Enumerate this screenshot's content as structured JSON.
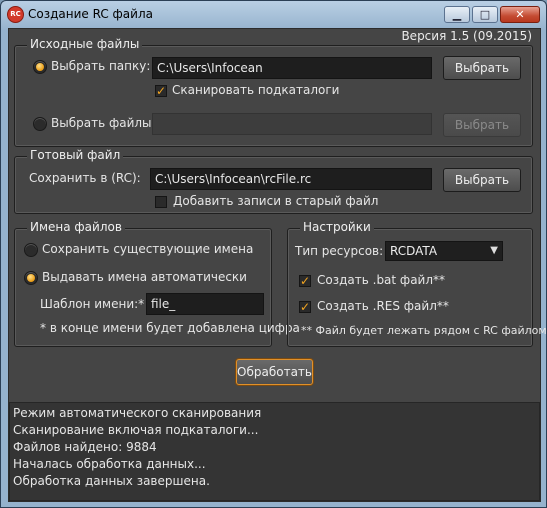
{
  "window": {
    "title": "Создание RC файла",
    "icon_name": "app-logo-icon",
    "controls": {
      "minimize": "▁",
      "maximize": "□",
      "close": "✕"
    }
  },
  "version": "Версия 1.5 (09.2015)",
  "source": {
    "legend": "Исходные файлы",
    "folder_option": "Выбрать папку:",
    "folder_value": "C:\\Users\\Infocean",
    "folder_button": "Выбрать",
    "scan_subfolders": "Сканировать подкаталоги",
    "files_option": "Выбрать файлы:",
    "files_value": "",
    "files_button": "Выбрать"
  },
  "output": {
    "legend": "Готовый файл",
    "save_label": "Сохранить в (RC):",
    "save_value": "C:\\Users\\Infocean\\rcFile.rc",
    "save_button": "Выбрать",
    "append_label": "Добавить записи в старый файл"
  },
  "names": {
    "legend": "Имена файлов",
    "keep_existing": "Сохранить существующие имена",
    "auto_names": "Выдавать имена автоматически",
    "template_label": "Шаблон имени:*",
    "template_value": "file_",
    "note": "* в конце имени будет добавлена цифра"
  },
  "settings": {
    "legend": "Настройки",
    "resource_type_label": "Тип ресурсов:",
    "resource_type_value": "RCDATA",
    "create_bat": "Создать .bat файл**",
    "create_res": "Создать .RES файл**",
    "note": "** Файл будет лежать рядом с RC файлом"
  },
  "process_button": "Обработать",
  "log": [
    "Режим автоматического сканирования",
    "Сканирование включая подкаталоги...",
    "Файлов найдено: 9884",
    "Началась обработка данных...",
    "Обработка данных завершена."
  ],
  "colors": {
    "accent": "#f2a521",
    "panel": "#454545",
    "field": "#1e1e1e"
  }
}
